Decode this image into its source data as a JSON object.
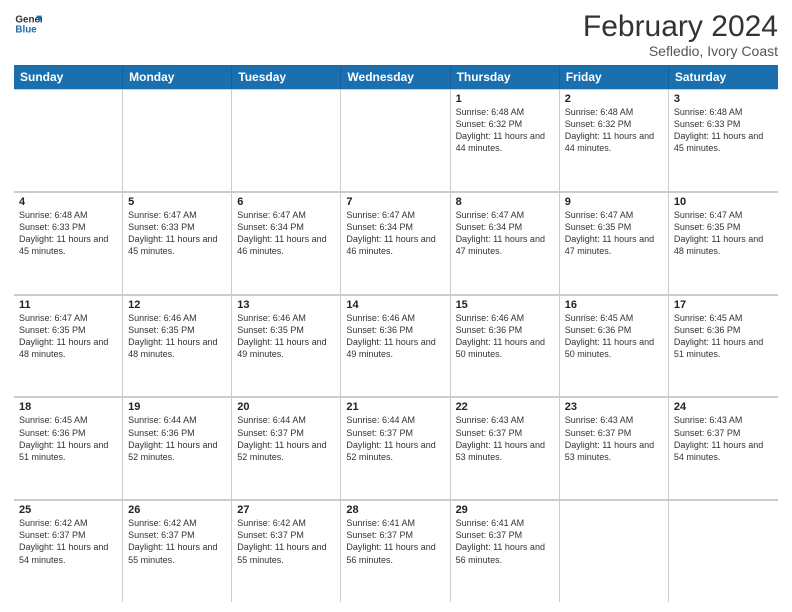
{
  "header": {
    "logo_line1": "General",
    "logo_line2": "Blue",
    "title": "February 2024",
    "subtitle": "Sefledio, Ivory Coast"
  },
  "days_of_week": [
    "Sunday",
    "Monday",
    "Tuesday",
    "Wednesday",
    "Thursday",
    "Friday",
    "Saturday"
  ],
  "weeks": [
    [
      {
        "day": "",
        "info": ""
      },
      {
        "day": "",
        "info": ""
      },
      {
        "day": "",
        "info": ""
      },
      {
        "day": "",
        "info": ""
      },
      {
        "day": "1",
        "info": "Sunrise: 6:48 AM\nSunset: 6:32 PM\nDaylight: 11 hours and 44 minutes."
      },
      {
        "day": "2",
        "info": "Sunrise: 6:48 AM\nSunset: 6:32 PM\nDaylight: 11 hours and 44 minutes."
      },
      {
        "day": "3",
        "info": "Sunrise: 6:48 AM\nSunset: 6:33 PM\nDaylight: 11 hours and 45 minutes."
      }
    ],
    [
      {
        "day": "4",
        "info": "Sunrise: 6:48 AM\nSunset: 6:33 PM\nDaylight: 11 hours and 45 minutes."
      },
      {
        "day": "5",
        "info": "Sunrise: 6:47 AM\nSunset: 6:33 PM\nDaylight: 11 hours and 45 minutes."
      },
      {
        "day": "6",
        "info": "Sunrise: 6:47 AM\nSunset: 6:34 PM\nDaylight: 11 hours and 46 minutes."
      },
      {
        "day": "7",
        "info": "Sunrise: 6:47 AM\nSunset: 6:34 PM\nDaylight: 11 hours and 46 minutes."
      },
      {
        "day": "8",
        "info": "Sunrise: 6:47 AM\nSunset: 6:34 PM\nDaylight: 11 hours and 47 minutes."
      },
      {
        "day": "9",
        "info": "Sunrise: 6:47 AM\nSunset: 6:35 PM\nDaylight: 11 hours and 47 minutes."
      },
      {
        "day": "10",
        "info": "Sunrise: 6:47 AM\nSunset: 6:35 PM\nDaylight: 11 hours and 48 minutes."
      }
    ],
    [
      {
        "day": "11",
        "info": "Sunrise: 6:47 AM\nSunset: 6:35 PM\nDaylight: 11 hours and 48 minutes."
      },
      {
        "day": "12",
        "info": "Sunrise: 6:46 AM\nSunset: 6:35 PM\nDaylight: 11 hours and 48 minutes."
      },
      {
        "day": "13",
        "info": "Sunrise: 6:46 AM\nSunset: 6:35 PM\nDaylight: 11 hours and 49 minutes."
      },
      {
        "day": "14",
        "info": "Sunrise: 6:46 AM\nSunset: 6:36 PM\nDaylight: 11 hours and 49 minutes."
      },
      {
        "day": "15",
        "info": "Sunrise: 6:46 AM\nSunset: 6:36 PM\nDaylight: 11 hours and 50 minutes."
      },
      {
        "day": "16",
        "info": "Sunrise: 6:45 AM\nSunset: 6:36 PM\nDaylight: 11 hours and 50 minutes."
      },
      {
        "day": "17",
        "info": "Sunrise: 6:45 AM\nSunset: 6:36 PM\nDaylight: 11 hours and 51 minutes."
      }
    ],
    [
      {
        "day": "18",
        "info": "Sunrise: 6:45 AM\nSunset: 6:36 PM\nDaylight: 11 hours and 51 minutes."
      },
      {
        "day": "19",
        "info": "Sunrise: 6:44 AM\nSunset: 6:36 PM\nDaylight: 11 hours and 52 minutes."
      },
      {
        "day": "20",
        "info": "Sunrise: 6:44 AM\nSunset: 6:37 PM\nDaylight: 11 hours and 52 minutes."
      },
      {
        "day": "21",
        "info": "Sunrise: 6:44 AM\nSunset: 6:37 PM\nDaylight: 11 hours and 52 minutes."
      },
      {
        "day": "22",
        "info": "Sunrise: 6:43 AM\nSunset: 6:37 PM\nDaylight: 11 hours and 53 minutes."
      },
      {
        "day": "23",
        "info": "Sunrise: 6:43 AM\nSunset: 6:37 PM\nDaylight: 11 hours and 53 minutes."
      },
      {
        "day": "24",
        "info": "Sunrise: 6:43 AM\nSunset: 6:37 PM\nDaylight: 11 hours and 54 minutes."
      }
    ],
    [
      {
        "day": "25",
        "info": "Sunrise: 6:42 AM\nSunset: 6:37 PM\nDaylight: 11 hours and 54 minutes."
      },
      {
        "day": "26",
        "info": "Sunrise: 6:42 AM\nSunset: 6:37 PM\nDaylight: 11 hours and 55 minutes."
      },
      {
        "day": "27",
        "info": "Sunrise: 6:42 AM\nSunset: 6:37 PM\nDaylight: 11 hours and 55 minutes."
      },
      {
        "day": "28",
        "info": "Sunrise: 6:41 AM\nSunset: 6:37 PM\nDaylight: 11 hours and 56 minutes."
      },
      {
        "day": "29",
        "info": "Sunrise: 6:41 AM\nSunset: 6:37 PM\nDaylight: 11 hours and 56 minutes."
      },
      {
        "day": "",
        "info": ""
      },
      {
        "day": "",
        "info": ""
      }
    ]
  ]
}
